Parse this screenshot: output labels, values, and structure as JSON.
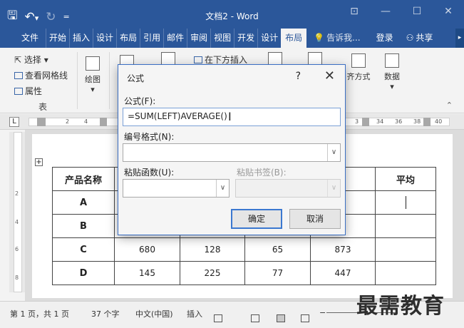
{
  "window": {
    "title": "文档2 - Word",
    "qat_icons": [
      "save-icon",
      "undo-icon",
      "redo-icon",
      "customize-icon"
    ]
  },
  "tabs": [
    {
      "label": "文件"
    },
    {
      "label": "开始"
    },
    {
      "label": "插入"
    },
    {
      "label": "设计"
    },
    {
      "label": "布局"
    },
    {
      "label": "引用"
    },
    {
      "label": "邮件"
    },
    {
      "label": "审阅"
    },
    {
      "label": "视图"
    },
    {
      "label": "开发"
    },
    {
      "label": "设计"
    },
    {
      "label": "布局"
    }
  ],
  "tell_me": "告诉我...",
  "login": "登录",
  "share": "共享",
  "ribbon": {
    "select": "选择",
    "gridlines": "查看网格线",
    "properties": "属性",
    "table_group": "表",
    "draw": "绘图",
    "insert_below": "在下方插入",
    "align": "齐方式",
    "data": "数据"
  },
  "ruler": {
    "left_box": "L",
    "nums_left": [
      "2",
      "4"
    ],
    "nums_right": [
      "3",
      "34",
      "36",
      "38",
      "40"
    ]
  },
  "vruler_nums": [
    "2",
    "4",
    "6",
    "8"
  ],
  "table": {
    "headers": [
      "产品名称",
      "",
      "",
      "",
      "",
      "平均"
    ],
    "rows": [
      [
        "A",
        "",
        "",
        "",
        "",
        ""
      ],
      [
        "B",
        "",
        "",
        "",
        "",
        ""
      ],
      [
        "C",
        "680",
        "128",
        "65",
        "873",
        ""
      ],
      [
        "D",
        "145",
        "225",
        "77",
        "447",
        ""
      ]
    ]
  },
  "dialog": {
    "title": "公式",
    "help": "?",
    "close": "✕",
    "formula_label": "公式(F):",
    "formula_value": "=SUM(LEFT)AVERAGE()",
    "number_format_label": "编号格式(N):",
    "paste_function_label": "粘贴函数(U):",
    "paste_bookmark_label": "粘贴书签(B):",
    "ok": "确定",
    "cancel": "取消"
  },
  "status": {
    "page": "第 1 页，共 1 页",
    "words": "37 个字",
    "language": "中文(中国)",
    "mode": "插入"
  },
  "watermark": "最需教育"
}
